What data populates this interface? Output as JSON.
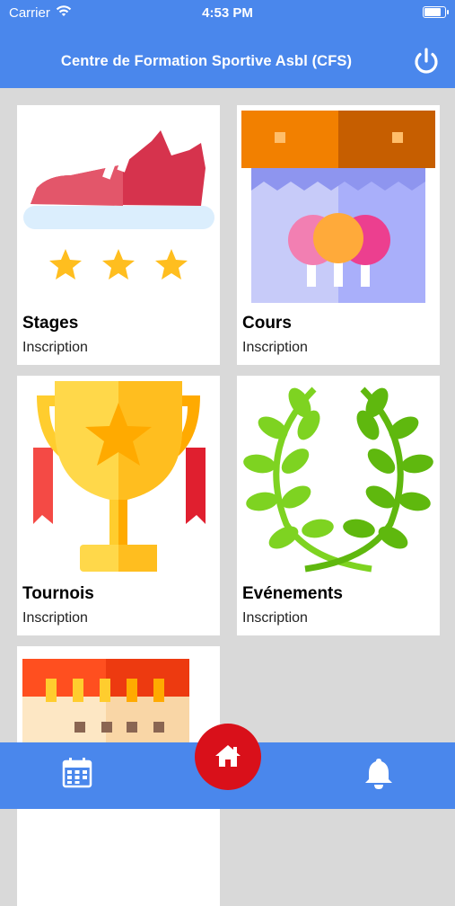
{
  "status": {
    "carrier": "Carrier",
    "time": "4:53 PM",
    "battery_level": 0.9
  },
  "header": {
    "title": "Centre de Formation Sportive Asbl (CFS)",
    "power_icon": "power-icon"
  },
  "cards": [
    {
      "title": "Stages",
      "subtitle": "Inscription",
      "icon": "sneaker-stars-icon"
    },
    {
      "title": "Cours",
      "subtitle": "Inscription",
      "icon": "ping-pong-store-icon"
    },
    {
      "title": "Tournois",
      "subtitle": "Inscription",
      "icon": "trophy-icon"
    },
    {
      "title": "Evénements",
      "subtitle": "Inscription",
      "icon": "laurel-wreath-icon"
    },
    {
      "title": "",
      "subtitle": "",
      "icon": "calendar-building-icon"
    }
  ],
  "tabbar": {
    "left_icon": "calendar-icon",
    "center_icon": "home-icon",
    "right_icon": "bell-icon"
  },
  "colors": {
    "primary": "#4a87ec",
    "home_button": "#d9101a",
    "background": "#d9d9d9"
  }
}
